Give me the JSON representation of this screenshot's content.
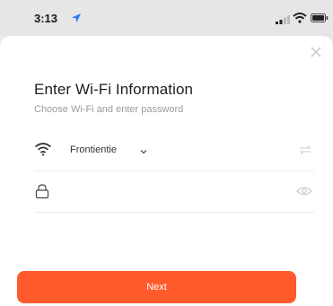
{
  "status_bar": {
    "time": "3:13",
    "icons": [
      "location-arrow-icon",
      "signal-bars-icon",
      "wifi-icon",
      "battery-icon"
    ]
  },
  "dialog": {
    "close_icon": "close-icon",
    "title": "Enter Wi-Fi Information",
    "subtitle": "Choose Wi-Fi and enter password",
    "wifi_field": {
      "ssid": "Frontientie",
      "icon": "wifi-icon",
      "dropdown_icon": "chevron-down-icon",
      "switch_icon": "switch-arrows-icon"
    },
    "password_field": {
      "value": "",
      "placeholder": "",
      "lock_icon": "lock-icon",
      "visibility_icon": "eye-icon"
    },
    "next_button": "Next"
  },
  "colors": {
    "accent": "#ff5a2c",
    "location_arrow": "#2f7cf6",
    "status_bar_bg": "#e6e6e6",
    "sheet_bg": "#ffffff"
  }
}
